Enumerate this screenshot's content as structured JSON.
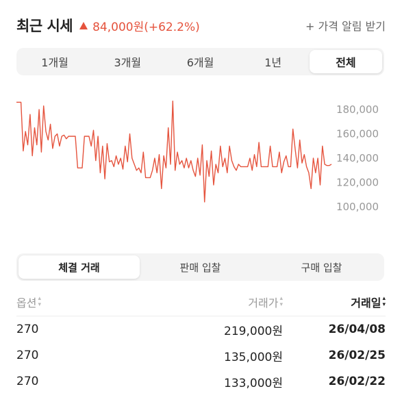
{
  "header": {
    "title": "최근 시세",
    "change_text": "84,000원(+62.2%)",
    "alert_label": "+ 가격 알림 받기",
    "accent_color": "#e5533d"
  },
  "period_tabs": [
    {
      "label": "1개월",
      "active": false
    },
    {
      "label": "3개월",
      "active": false
    },
    {
      "label": "6개월",
      "active": false
    },
    {
      "label": "1년",
      "active": false
    },
    {
      "label": "전체",
      "active": true
    }
  ],
  "chart_data": {
    "type": "line",
    "color": "#e5533d",
    "grid": false,
    "y_axis_side": "right",
    "ylim": [
      95000,
      190000
    ],
    "y_ticks": [
      180000,
      160000,
      140000,
      120000,
      100000
    ],
    "y_tick_labels": [
      "180,000",
      "160,000",
      "140,000",
      "120,000",
      "100,000"
    ],
    "x_description": "trade sequence (no x labels shown)",
    "values": [
      186000,
      186000,
      186000,
      146000,
      162000,
      151000,
      176000,
      142000,
      165000,
      151000,
      180000,
      145000,
      183000,
      162000,
      155000,
      168000,
      148000,
      158000,
      160000,
      150000,
      158000,
      159000,
      156000,
      158000,
      158000,
      158000,
      158000,
      132000,
      132000,
      132000,
      158000,
      158000,
      158000,
      150000,
      163000,
      138000,
      158000,
      128000,
      150000,
      123000,
      152000,
      137000,
      138000,
      133000,
      142000,
      135000,
      140000,
      131000,
      150000,
      137000,
      160000,
      140000,
      135000,
      130000,
      132000,
      128000,
      145000,
      124000,
      124000,
      124000,
      130000,
      140000,
      128000,
      143000,
      115000,
      142000,
      132000,
      165000,
      135000,
      187000,
      130000,
      145000,
      135000,
      138000,
      132000,
      140000,
      132000,
      138000,
      130000,
      125000,
      140000,
      126000,
      151000,
      104000,
      138000,
      125000,
      146000,
      118000,
      135000,
      128000,
      150000,
      133000,
      140000,
      128000,
      150000,
      138000,
      133000,
      130000,
      135000,
      133000,
      133000,
      133000,
      133000,
      140000,
      130000,
      143000,
      133000,
      153000,
      133000,
      133000,
      133000,
      133000,
      150000,
      133000,
      133000,
      133000,
      145000,
      128000,
      137000,
      142000,
      133000,
      133000,
      164000,
      147000,
      132000,
      155000,
      136000,
      143000,
      133000,
      128000,
      115000,
      140000,
      128000,
      140000,
      118000,
      150000,
      135000,
      134000,
      134000,
      135000
    ]
  },
  "trade_tabs": [
    {
      "label": "체결 거래",
      "active": true
    },
    {
      "label": "판매 입찰",
      "active": false
    },
    {
      "label": "구매 입찰",
      "active": false
    }
  ],
  "table": {
    "headers": {
      "option": "옵션",
      "price": "거래가",
      "date": "거래일"
    },
    "rows": [
      {
        "option": "270",
        "price": "219,000원",
        "date": "26/04/08"
      },
      {
        "option": "270",
        "price": "135,000원",
        "date": "26/02/25"
      },
      {
        "option": "270",
        "price": "133,000원",
        "date": "26/02/22"
      }
    ]
  }
}
